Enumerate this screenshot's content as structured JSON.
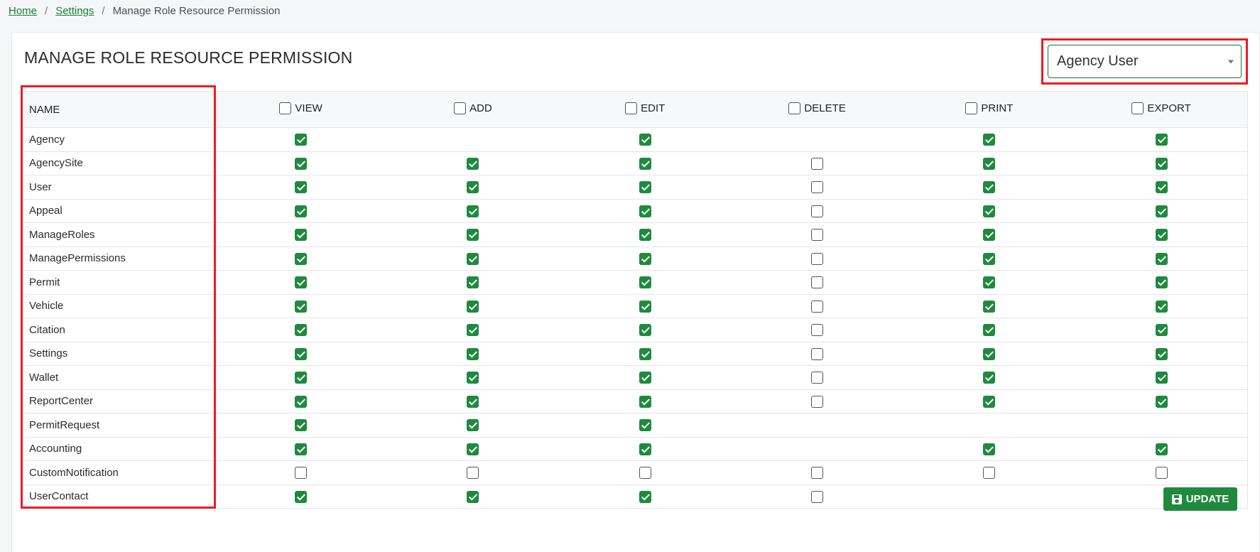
{
  "breadcrumb": {
    "home": "Home",
    "settings": "Settings",
    "separator": "/",
    "current": "Manage Role Resource Permission"
  },
  "page": {
    "title": "MANAGE ROLE RESOURCE PERMISSION"
  },
  "role_select": {
    "selected": "Agency User"
  },
  "table": {
    "name_header": "NAME",
    "columns": [
      "VIEW",
      "ADD",
      "EDIT",
      "DELETE",
      "PRINT",
      "EXPORT"
    ],
    "header_checked": [
      false,
      false,
      false,
      false,
      false,
      false
    ],
    "rows": [
      {
        "name": "Agency",
        "perms": [
          true,
          null,
          true,
          null,
          true,
          true
        ]
      },
      {
        "name": "AgencySite",
        "perms": [
          true,
          true,
          true,
          false,
          true,
          true
        ]
      },
      {
        "name": "User",
        "perms": [
          true,
          true,
          true,
          false,
          true,
          true
        ]
      },
      {
        "name": "Appeal",
        "perms": [
          true,
          true,
          true,
          false,
          true,
          true
        ]
      },
      {
        "name": "ManageRoles",
        "perms": [
          true,
          true,
          true,
          false,
          true,
          true
        ]
      },
      {
        "name": "ManagePermissions",
        "perms": [
          true,
          true,
          true,
          false,
          true,
          true
        ]
      },
      {
        "name": "Permit",
        "perms": [
          true,
          true,
          true,
          false,
          true,
          true
        ]
      },
      {
        "name": "Vehicle",
        "perms": [
          true,
          true,
          true,
          false,
          true,
          true
        ]
      },
      {
        "name": "Citation",
        "perms": [
          true,
          true,
          true,
          false,
          true,
          true
        ]
      },
      {
        "name": "Settings",
        "perms": [
          true,
          true,
          true,
          false,
          true,
          true
        ]
      },
      {
        "name": "Wallet",
        "perms": [
          true,
          true,
          true,
          false,
          true,
          true
        ]
      },
      {
        "name": "ReportCenter",
        "perms": [
          true,
          true,
          true,
          false,
          true,
          true
        ]
      },
      {
        "name": "PermitRequest",
        "perms": [
          true,
          true,
          true,
          null,
          null,
          null
        ]
      },
      {
        "name": "Accounting",
        "perms": [
          true,
          true,
          true,
          null,
          true,
          true
        ]
      },
      {
        "name": "CustomNotification",
        "perms": [
          false,
          false,
          false,
          false,
          false,
          false
        ]
      },
      {
        "name": "UserContact",
        "perms": [
          true,
          true,
          true,
          false,
          null,
          null
        ]
      }
    ]
  },
  "actions": {
    "update_label": "UPDATE"
  },
  "colors": {
    "accent_green": "#1f8a3e",
    "highlight_red": "#ee1c25"
  }
}
